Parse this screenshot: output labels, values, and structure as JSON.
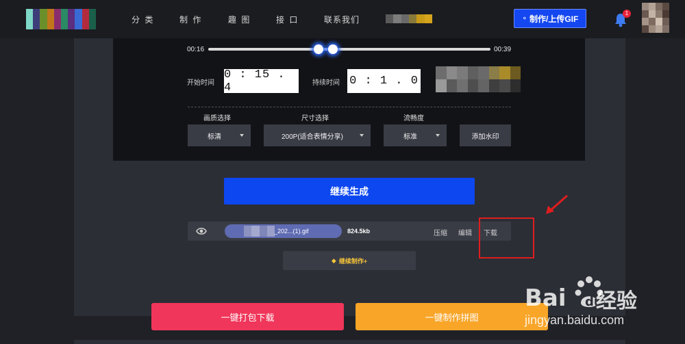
{
  "nav": {
    "items": [
      "分 类",
      "制 作",
      "趣 图",
      "接 口",
      "联系我们"
    ],
    "make_button": "制作/上传GIF",
    "notification_count": "1",
    "logo_colors": [
      "#7fd7c7",
      "#3d3d7a",
      "#6b8f2a",
      "#c2761c",
      "#8a2d6d",
      "#2a8a63",
      "#5b2e80",
      "#3a6ad4",
      "#b22b3c",
      "#1a5f4a"
    ]
  },
  "editor": {
    "start_time_label": "00:16",
    "end_time_label": "00:39",
    "start_field_label": "开始时间",
    "start_time_value": "0 : 15 . 4",
    "duration_field_label": "持续时间",
    "duration_value": "0 : 1 . 0",
    "quality_label": "画质选择",
    "quality_value": "标清",
    "size_label": "尺寸选择",
    "size_value": "200P(适合表情分享)",
    "fluency_label": "流畅度",
    "fluency_value": "标准",
    "watermark_button": "添加水印"
  },
  "generate_button": "继续生成",
  "file": {
    "name": "_202...(1).gif",
    "size": "824.5kb",
    "actions": [
      "压缩",
      "编辑",
      "下载"
    ]
  },
  "continue_button": "继续制作+",
  "pack_download_button": "一键打包下载",
  "puzzle_button": "一键制作拼图",
  "watermark": {
    "brand": "Bai 经验",
    "url": "jingyan.baidu.com"
  },
  "colors": {
    "accent_blue": "#0d47f0",
    "pink": "#f0365a",
    "orange": "#f8a528",
    "annotation_red": "#e01d1d"
  }
}
